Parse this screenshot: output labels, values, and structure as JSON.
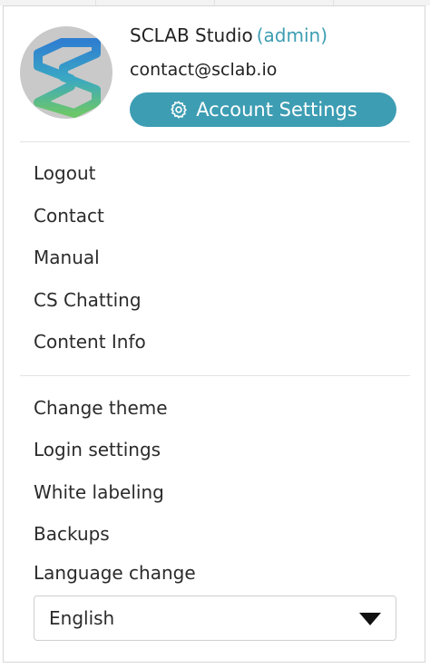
{
  "profile": {
    "name": "SCLAB Studio",
    "role": "(admin)",
    "email": "contact@sclab.io",
    "account_settings_label": "Account Settings",
    "accent_color": "#3d9db3"
  },
  "menu_group_1": [
    {
      "label": "Logout"
    },
    {
      "label": "Contact"
    },
    {
      "label": "Manual"
    },
    {
      "label": "CS Chatting"
    },
    {
      "label": "Content Info"
    }
  ],
  "menu_group_2": [
    {
      "label": "Change theme"
    },
    {
      "label": "Login settings"
    },
    {
      "label": "White labeling"
    },
    {
      "label": "Backups"
    }
  ],
  "language": {
    "label": "Language change",
    "selected": "English"
  },
  "icons": {
    "avatar": "sclab-logo-icon",
    "settings": "gear-icon",
    "dropdown": "caret-down-icon"
  }
}
